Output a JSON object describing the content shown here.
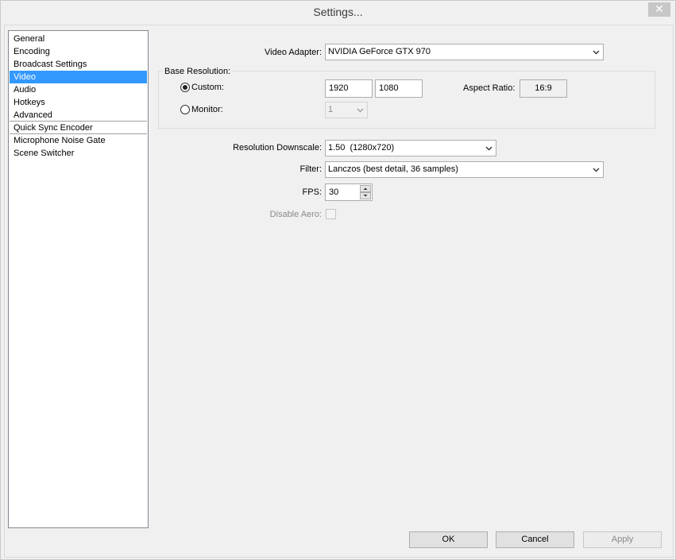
{
  "window": {
    "title": "Settings...",
    "close_glyph": "✕"
  },
  "nav": {
    "items": [
      {
        "label": "General"
      },
      {
        "label": "Encoding"
      },
      {
        "label": "Broadcast Settings"
      },
      {
        "label": "Video",
        "selected": true
      },
      {
        "label": "Audio"
      },
      {
        "label": "Hotkeys"
      },
      {
        "label": "Advanced"
      },
      {
        "label": "Quick Sync Encoder"
      },
      {
        "label": "Microphone Noise Gate"
      },
      {
        "label": "Scene Switcher"
      }
    ]
  },
  "video": {
    "adapter_label": "Video Adapter:",
    "adapter_value": "NVIDIA GeForce GTX 970",
    "base_resolution_label": "Base Resolution:",
    "custom_label": "Custom:",
    "custom_selected": true,
    "width": "1920",
    "height": "1080",
    "aspect_ratio_label": "Aspect Ratio:",
    "aspect_ratio_value": "16:9",
    "monitor_label": "Monitor:",
    "monitor_value": "1",
    "downscale_label": "Resolution Downscale:",
    "downscale_value": "1.50  (1280x720)",
    "filter_label": "Filter:",
    "filter_value": "Lanczos (best detail, 36 samples)",
    "fps_label": "FPS:",
    "fps_value": "30",
    "disable_aero_label": "Disable Aero:",
    "disable_aero_checked": false
  },
  "buttons": {
    "ok": "OK",
    "cancel": "Cancel",
    "apply": "Apply"
  },
  "colors": {
    "selection": "#3399ff",
    "background": "#f0f0f0"
  }
}
